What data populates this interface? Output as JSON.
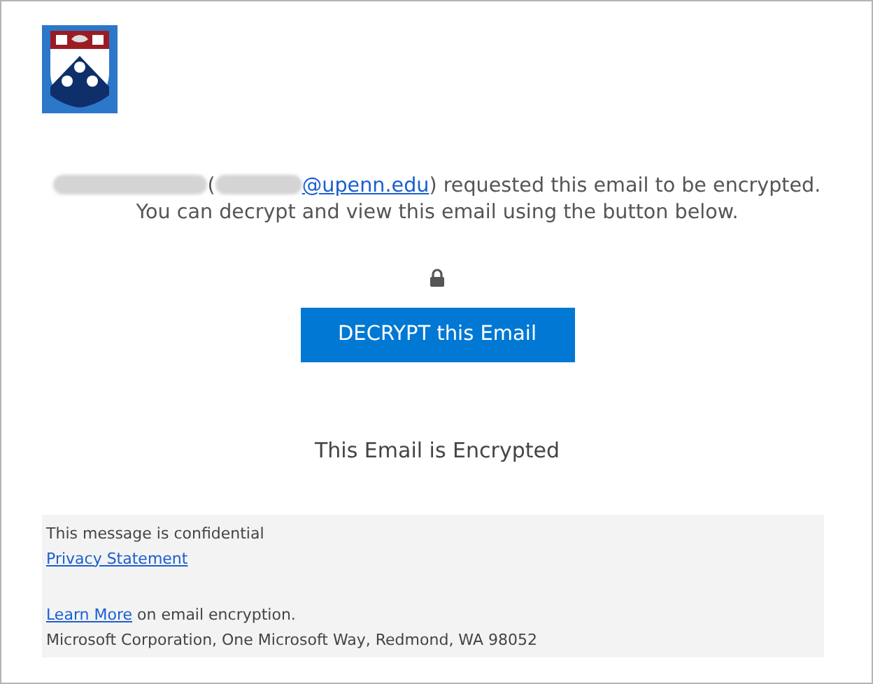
{
  "message": {
    "before": "(",
    "link": "@upenn.edu",
    "after": ") requested this email to be encrypted. You can decrypt and view this email using the button below."
  },
  "decrypt_button": {
    "label": "DECRYPT this Email"
  },
  "status": "This Email is Encrypted",
  "footer": {
    "confidential": "This message is confidential",
    "privacy_link": "Privacy Statement",
    "learn_link": "Learn More",
    "learn_text": " on email encryption.",
    "address": "Microsoft Corporation, One Microsoft Way, Redmond, WA 98052"
  }
}
